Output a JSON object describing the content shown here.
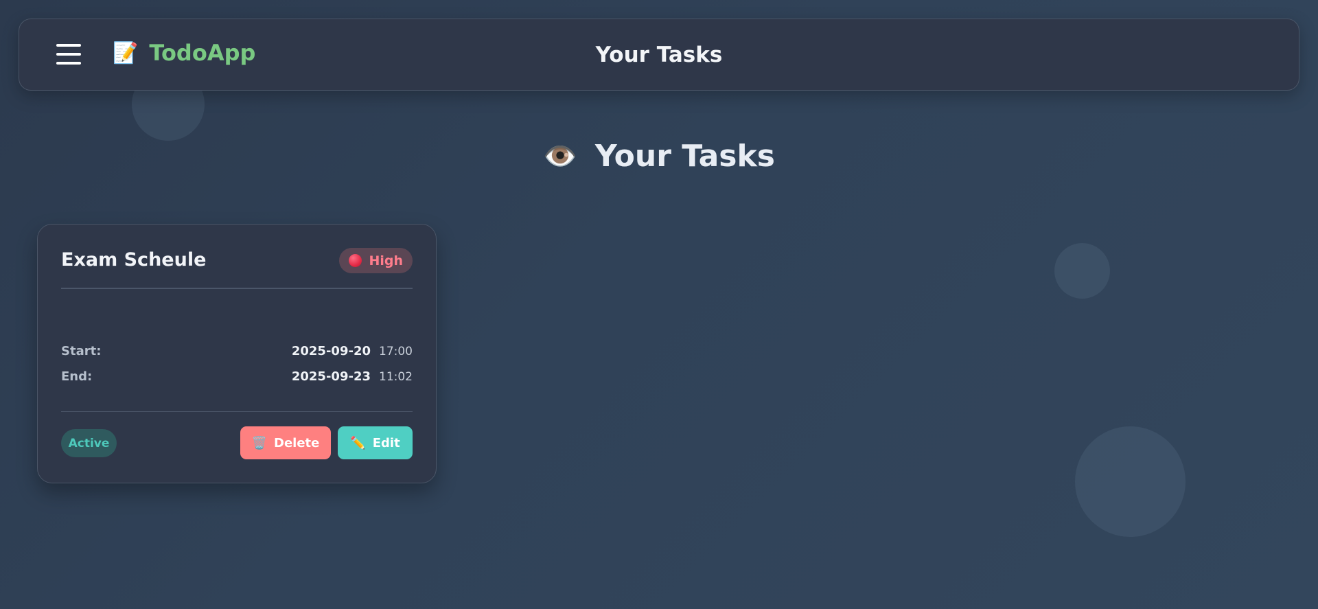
{
  "navbar": {
    "menu_icon": "hamburger-menu-icon",
    "brand_icon": "📝",
    "brand_name": "TodoApp",
    "title": "Your Tasks"
  },
  "page": {
    "heading_icon": "👁️",
    "heading": "Your Tasks"
  },
  "task": {
    "title": "Exam Scheule",
    "priority": "High",
    "priority_color": "#e42a46",
    "start_label": "Start:",
    "start_date": "2025-09-20",
    "start_time": "17:00",
    "end_label": "End:",
    "end_date": "2025-09-23",
    "end_time": "11:02",
    "status": "Active",
    "delete_icon": "🗑️",
    "delete_label": "Delete",
    "edit_icon": "✏️",
    "edit_label": "Edit"
  },
  "colors": {
    "brand": "#7ac982",
    "delete_button": "#fe8080",
    "edit_button": "#4fcfc3",
    "status": "#4ec9bb"
  }
}
